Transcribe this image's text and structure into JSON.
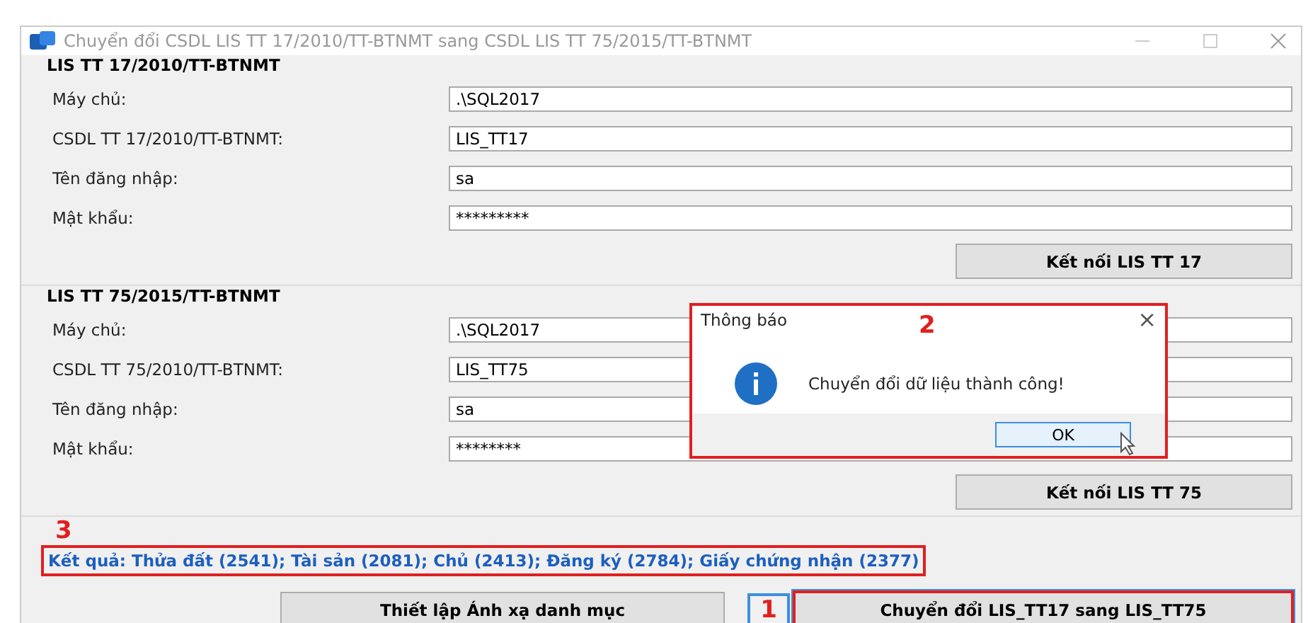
{
  "window": {
    "title": "Chuyển đổi CSDL LIS TT 17/2010/TT-BTNMT sang CSDL LIS TT 75/2015/TT-BTNMT"
  },
  "groups": [
    {
      "title": "LIS TT 17/2010/TT-BTNMT",
      "fields": [
        {
          "label": "Máy chủ:",
          "value": ".\\SQL2017"
        },
        {
          "label": "CSDL TT 17/2010/TT-BTNMT:",
          "value": "LIS_TT17"
        },
        {
          "label": "Tên đăng nhập:",
          "value": "sa"
        },
        {
          "label": "Mật khẩu:",
          "value": "*********"
        }
      ],
      "button": "Kết nối LIS TT 17"
    },
    {
      "title": "LIS TT 75/2015/TT-BTNMT",
      "fields": [
        {
          "label": "Máy chủ:",
          "value": ".\\SQL2017"
        },
        {
          "label": "CSDL TT 75/2010/TT-BTNMT:",
          "value": "LIS_TT75"
        },
        {
          "label": "Tên đăng nhập:",
          "value": "sa"
        },
        {
          "label": "Mật khẩu:",
          "value": "********"
        }
      ],
      "button": "Kết nối LIS TT 75"
    }
  ],
  "result": {
    "marker": "3",
    "text": "Kết quả: Thửa đất (2541); Tài sản (2081); Chủ (2413); Đăng ký (2784); Giấy chứng nhận (2377)"
  },
  "buttons": {
    "mapping": "Thiết lập Ánh xạ danh mục",
    "convert_marker": "1",
    "convert": "Chuyển đổi LIS_TT17 sang LIS_TT75"
  },
  "dialog": {
    "title": "Thông báo",
    "marker": "2",
    "close": "×",
    "message": "Chuyển đổi dữ liệu thành công!",
    "button": "OK"
  }
}
